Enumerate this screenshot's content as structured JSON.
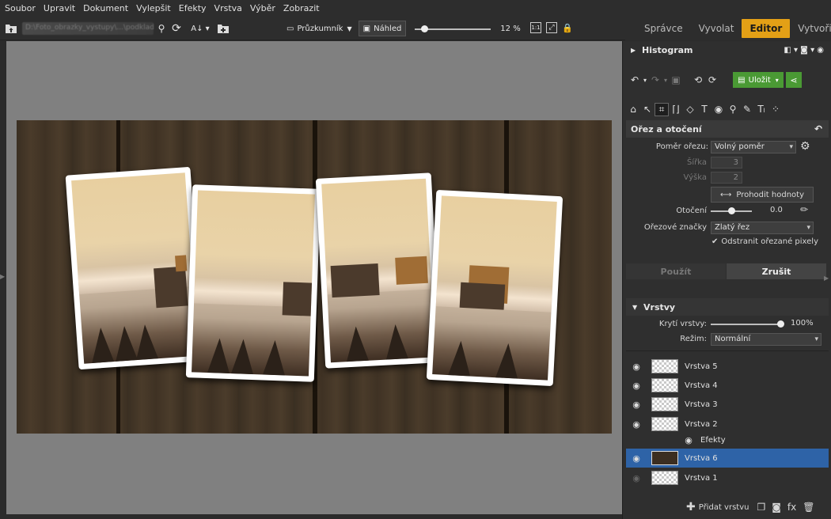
{
  "menu": [
    "Soubor",
    "Upravit",
    "Dokument",
    "Vylepšit",
    "Efekty",
    "Vrstva",
    "Výběr",
    "Zobrazit"
  ],
  "toolbar": {
    "path_text": "D:\\Foto_obrazky_vystupy\\...\\podklady",
    "browser_label": "Průzkumník",
    "preview_label": "Náhled",
    "zoom_text": "12 %",
    "zoom_level": 12,
    "one_to_one": "1:1"
  },
  "modes": {
    "items": [
      "Správce",
      "Vyvolat",
      "Editor",
      "Vytvořit"
    ],
    "active": "Editor"
  },
  "panel": {
    "histogram_title": "Histogram",
    "save_label": "Uložit",
    "crop": {
      "title": "Ořez a otočení",
      "ratio_label": "Poměr ořezu:",
      "ratio_value": "Volný poměr",
      "width_label": "Šířka",
      "width_value": "3",
      "height_label": "Výška",
      "height_value": "2",
      "swap_label": "Prohodit hodnoty",
      "rotation_label": "Otočení",
      "rotation_value": "0.0",
      "rotation_fraction": 0.5,
      "marks_label": "Ořezové značky",
      "marks_value": "Zlatý řez",
      "remove_label": "Odstranit ořezané pixely",
      "apply_label": "Použít",
      "cancel_label": "Zrušit"
    },
    "layers": {
      "title": "Vrstvy",
      "opacity_label": "Krytí vrstvy:",
      "opacity_value": "100%",
      "opacity_fraction": 1.0,
      "mode_label": "Režim:",
      "mode_value": "Normální",
      "items": [
        {
          "name": "Vrstva 5",
          "selected": false
        },
        {
          "name": "Vrstva 4",
          "selected": false
        },
        {
          "name": "Vrstva 3",
          "selected": false
        },
        {
          "name": "Vrstva 2",
          "selected": false
        },
        {
          "name": "Efekty",
          "selected": false
        },
        {
          "name": "Vrstva 6",
          "selected": true
        },
        {
          "name": "Vrstva 1",
          "selected": false
        }
      ],
      "add_label": "Přidat vrstvu",
      "fx_label": "fx"
    }
  },
  "colors": {
    "accent": "#e3a016",
    "selection": "#2e63a7",
    "save": "#4a9a34"
  }
}
